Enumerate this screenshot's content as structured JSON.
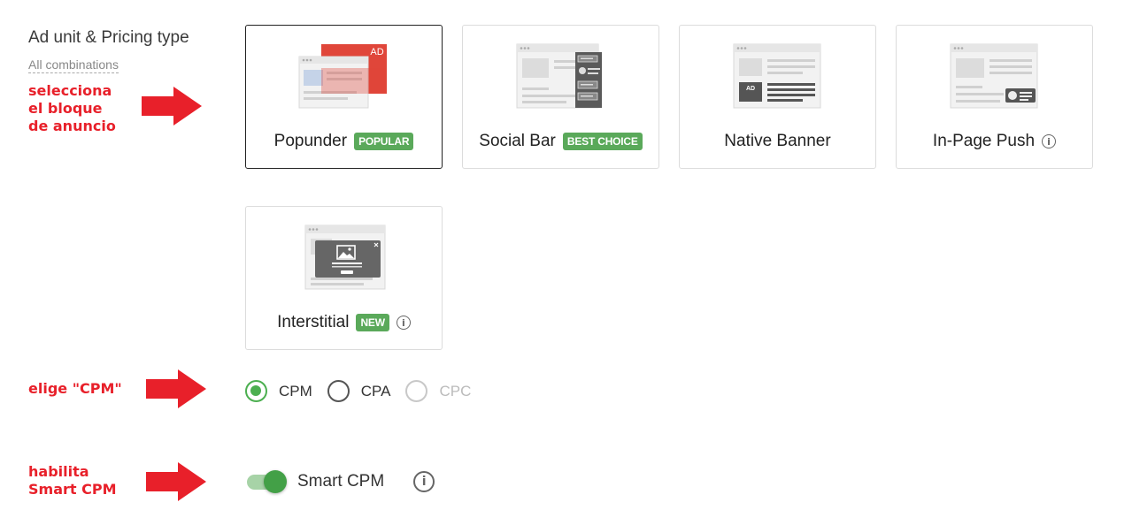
{
  "section": {
    "title": "Ad unit & Pricing type",
    "subtitle": "All combinations"
  },
  "annotations": {
    "select_block": [
      "selecciona",
      "el bloque",
      "de anuncio"
    ],
    "choose_cpm": "elige \"CPM\"",
    "enable_smart": [
      "habilita",
      "Smart CPM"
    ]
  },
  "ad_units": [
    {
      "label": "Popunder",
      "badge": "POPULAR",
      "selected": true,
      "thumb_text": "AD"
    },
    {
      "label": "Social Bar",
      "badge": "BEST CHOICE",
      "selected": false
    },
    {
      "label": "Native Banner",
      "selected": false,
      "thumb_text": "AD"
    },
    {
      "label": "In-Page Push",
      "info": "i",
      "selected": false
    },
    {
      "label": "Interstitial",
      "badge": "NEW",
      "info": "i",
      "selected": false
    }
  ],
  "pricing": {
    "options": [
      {
        "label": "CPM",
        "checked": true,
        "disabled": false
      },
      {
        "label": "CPA",
        "checked": false,
        "disabled": false
      },
      {
        "label": "CPC",
        "checked": false,
        "disabled": true
      }
    ]
  },
  "smart_cpm": {
    "label": "Smart CPM",
    "enabled": true,
    "info": "i"
  },
  "colors": {
    "accent_green": "#4caf50",
    "annotation_red": "#e8202a",
    "badge_green": "#5aa95a"
  }
}
